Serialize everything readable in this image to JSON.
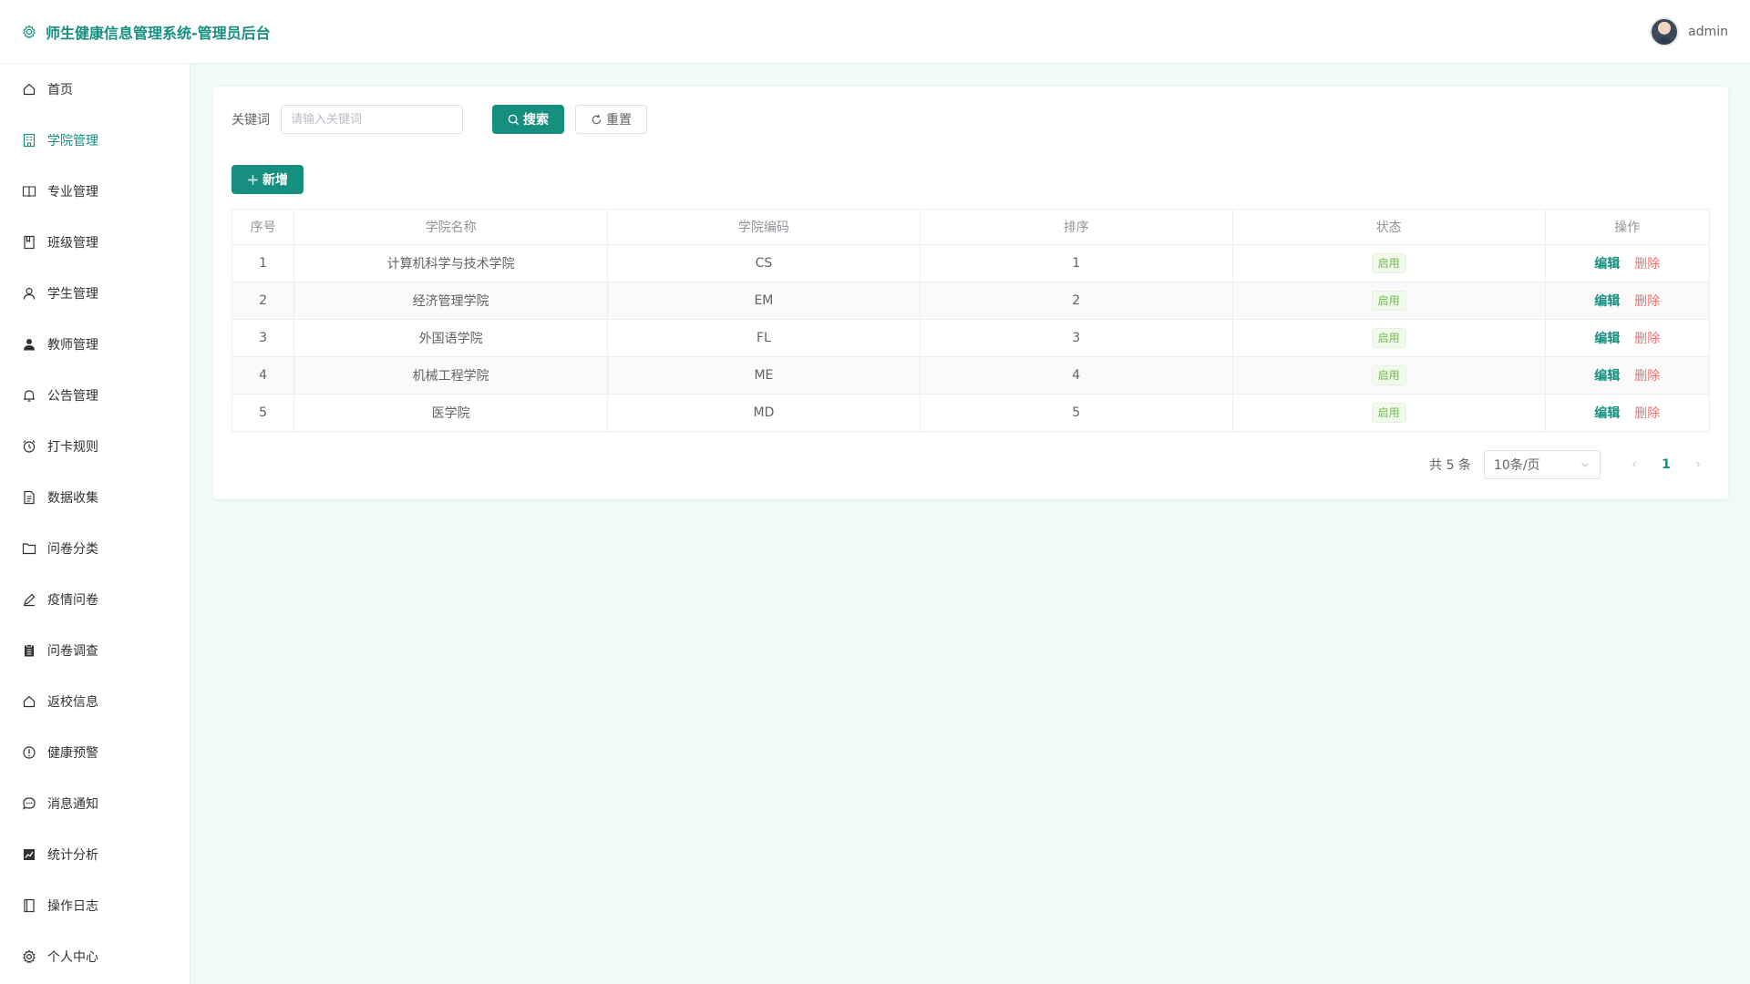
{
  "header": {
    "title": "师生健康信息管理系统-管理员后台",
    "user": "admin",
    "accent": "#168f7f"
  },
  "sidebar": {
    "items": [
      {
        "label": "首页",
        "icon": "home-icon",
        "active": false
      },
      {
        "label": "学院管理",
        "icon": "building-icon",
        "active": true
      },
      {
        "label": "专业管理",
        "icon": "book-icon",
        "active": false
      },
      {
        "label": "班级管理",
        "icon": "notebook-icon",
        "active": false
      },
      {
        "label": "学生管理",
        "icon": "user-icon",
        "active": false
      },
      {
        "label": "教师管理",
        "icon": "user-solid-icon",
        "active": false
      },
      {
        "label": "公告管理",
        "icon": "bell-icon",
        "active": false
      },
      {
        "label": "打卡规则",
        "icon": "alarm-clock-icon",
        "active": false
      },
      {
        "label": "数据收集",
        "icon": "document-icon",
        "active": false
      },
      {
        "label": "问卷分类",
        "icon": "folder-icon",
        "active": false
      },
      {
        "label": "疫情问卷",
        "icon": "edit-pen-icon",
        "active": false
      },
      {
        "label": "问卷调查",
        "icon": "clipboard-icon",
        "active": false
      },
      {
        "label": "返校信息",
        "icon": "house-icon",
        "active": false
      },
      {
        "label": "健康预警",
        "icon": "warning-icon",
        "active": false
      },
      {
        "label": "消息通知",
        "icon": "chat-icon",
        "active": false
      },
      {
        "label": "统计分析",
        "icon": "chart-icon",
        "active": false
      },
      {
        "label": "操作日志",
        "icon": "log-book-icon",
        "active": false
      },
      {
        "label": "个人中心",
        "icon": "gear-icon",
        "active": false
      }
    ]
  },
  "search": {
    "label": "关键词",
    "placeholder": "请输入关键词",
    "search_button": "搜索",
    "reset_button": "重置"
  },
  "add_button": "新增",
  "table": {
    "columns": [
      "序号",
      "学院名称",
      "学院编码",
      "排序",
      "状态",
      "操作"
    ],
    "rows": [
      {
        "index": "1",
        "name": "计算机科学与技术学院",
        "code": "CS",
        "sort": "1",
        "status": "启用"
      },
      {
        "index": "2",
        "name": "经济管理学院",
        "code": "EM",
        "sort": "2",
        "status": "启用"
      },
      {
        "index": "3",
        "name": "外国语学院",
        "code": "FL",
        "sort": "3",
        "status": "启用"
      },
      {
        "index": "4",
        "name": "机械工程学院",
        "code": "ME",
        "sort": "4",
        "status": "启用"
      },
      {
        "index": "5",
        "name": "医学院",
        "code": "MD",
        "sort": "5",
        "status": "启用"
      }
    ],
    "edit_label": "编辑",
    "delete_label": "删除"
  },
  "pagination": {
    "total": "共 5 条",
    "page_size": "10条/页",
    "current_page": "1",
    "prev": "‹",
    "next": "›"
  }
}
